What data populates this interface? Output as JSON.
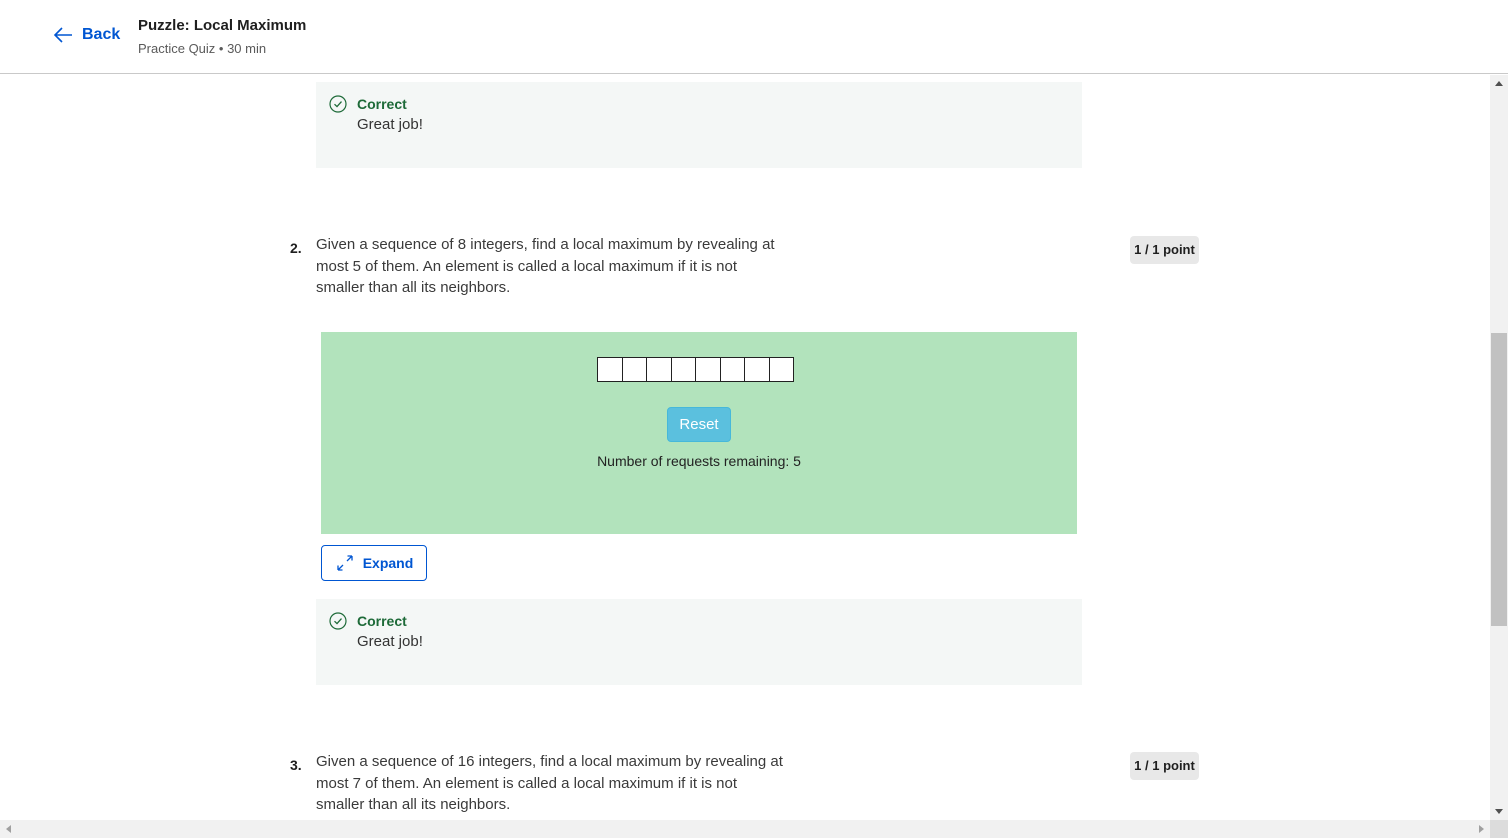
{
  "header": {
    "back_label": "Back",
    "title": "Puzzle: Local Maximum",
    "subtitle": "Practice Quiz • 30 min"
  },
  "feedback_top": {
    "title": "Correct",
    "message": "Great job!"
  },
  "question2": {
    "number": "2.",
    "text": "Given a sequence of 8 integers, find a local maximum by revealing at most 5 of them. An element is called a local maximum if it is not smaller than all its neighbors.",
    "points": "1 / 1 point",
    "puzzle": {
      "cell_count": 8,
      "reset_label": "Reset",
      "remaining_text": "Number of requests remaining: 5",
      "background_color": "#b2e3bc"
    },
    "expand_label": "Expand",
    "feedback": {
      "title": "Correct",
      "message": "Great job!"
    }
  },
  "question3": {
    "number": "3.",
    "text": "Given a sequence of 16 integers, find a local maximum by revealing at most 7 of them. An element is called a local maximum if it is not smaller than all its neighbors.",
    "points": "1 / 1 point"
  },
  "colors": {
    "accent": "#0056d2",
    "correct": "#1d6a38",
    "reset_button": "#5bc0de"
  },
  "icons": {
    "back": "arrow-left-icon",
    "correct": "check-circle-icon",
    "expand": "expand-arrows-icon"
  }
}
